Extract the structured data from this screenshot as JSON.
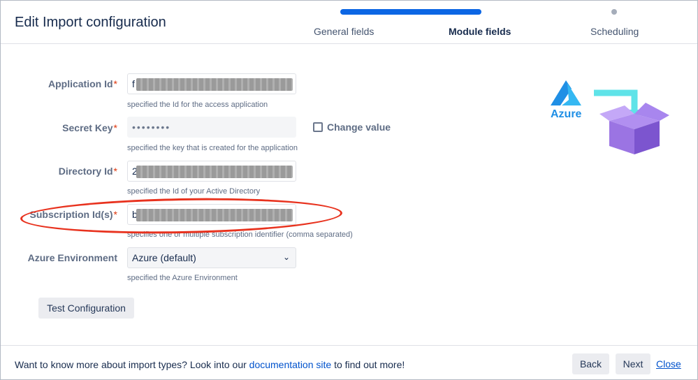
{
  "header": {
    "title": "Edit Import configuration",
    "steps": [
      {
        "label": "General fields"
      },
      {
        "label": "Module fields"
      },
      {
        "label": "Scheduling"
      }
    ]
  },
  "form": {
    "application_id": {
      "label": "Application Id",
      "required": "*",
      "value_prefix": "f",
      "help": "specified the Id for the access application"
    },
    "secret_key": {
      "label": "Secret Key",
      "required": "*",
      "value": "••••••••",
      "help": "specified the key that is created for the application"
    },
    "change_value": {
      "label": "Change value",
      "checked": false
    },
    "directory_id": {
      "label": "Directory Id",
      "required": "*",
      "value_prefix": "2",
      "help": "specified the Id of your Active Directory"
    },
    "subscription_ids": {
      "label": "Subscription Id(s)",
      "required": "*",
      "value_prefix": "b",
      "help": "specifies one or multiple subscription identifier (comma separated)"
    },
    "azure_environment": {
      "label": "Azure Environment",
      "value": "Azure (default)",
      "help": "specified the Azure Environment"
    }
  },
  "buttons": {
    "test_configuration": "Test Configuration",
    "back": "Back",
    "next": "Next",
    "close": "Close"
  },
  "footer": {
    "text_before": "Want to know more about import types? Look into our ",
    "link": "documentation site",
    "text_after": " to find out more!"
  },
  "illustration": {
    "azure_label": "Azure"
  },
  "colors": {
    "accent": "#0c66e4",
    "link": "#0052cc",
    "required": "#de350b",
    "annotation": "#e8321e",
    "azure": "#1f8fe5",
    "box": "#8e66d9"
  }
}
